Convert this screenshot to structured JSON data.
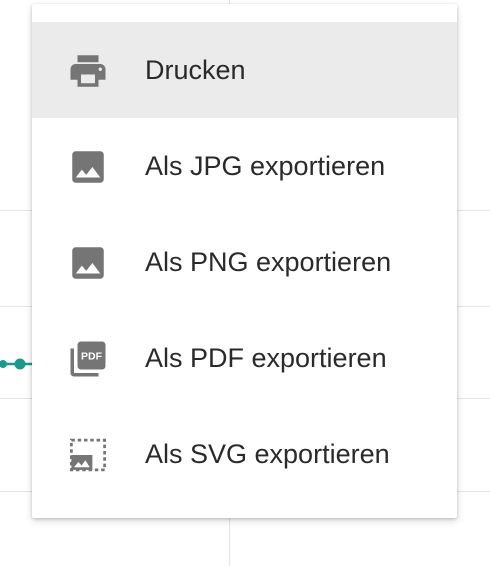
{
  "menu": {
    "items": [
      {
        "label": "Drucken",
        "icon": "printer-icon",
        "active": true
      },
      {
        "label": "Als JPG exportieren",
        "icon": "image-icon",
        "active": false
      },
      {
        "label": "Als PNG exportieren",
        "icon": "image-icon",
        "active": false
      },
      {
        "label": "Als PDF exportieren",
        "icon": "pdf-icon",
        "active": false
      },
      {
        "label": "Als SVG exportieren",
        "icon": "svg-image-icon",
        "active": false
      }
    ]
  },
  "colors": {
    "icon": "#757575",
    "hover_background": "#ebebeb",
    "text": "#2a2a2a",
    "series": "#1a9a8a",
    "gridline": "#e4e4e4"
  }
}
